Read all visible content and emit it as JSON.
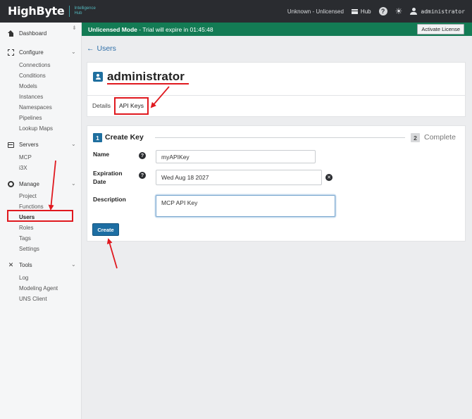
{
  "topbar": {
    "logo": "HighByte",
    "logo_sub_1": "Intelligence",
    "logo_sub_2": "Hub",
    "license_status": "Unknown - Unlicensed",
    "hub_label": "Hub",
    "help_glyph": "?",
    "theme_glyph": "☀",
    "username": "administrator"
  },
  "sidebar": {
    "pin_glyph": "⇟",
    "dashboard": "Dashboard",
    "configure": "Configure",
    "configure_items": [
      "Connections",
      "Conditions",
      "Models",
      "Instances",
      "Namespaces",
      "Pipelines",
      "Lookup Maps"
    ],
    "servers": "Servers",
    "servers_items": [
      "MCP",
      "i3X"
    ],
    "manage": "Manage",
    "manage_items": [
      "Project",
      "Functions",
      "Users",
      "Roles",
      "Tags",
      "Settings"
    ],
    "tools": "Tools",
    "tools_items": [
      "Log",
      "Modeling Agent",
      "UNS Client"
    ],
    "chevron": "⌄"
  },
  "banner": {
    "mode": "Unlicensed Mode",
    "message": " - Trial will expire in 01:45:48",
    "activate_label": "Activate License"
  },
  "page": {
    "back_arrow": "←",
    "back_label": "Users",
    "title": "administrator",
    "tabs": [
      "Details",
      "API Keys"
    ]
  },
  "wizard": {
    "step1_num": "1",
    "step1_label": "Create Key",
    "step2_num": "2",
    "step2_label": "Complete",
    "name_label": "Name",
    "name_value": "myAPIKey",
    "expiration_label_1": "Expiration",
    "expiration_label_2": "Date",
    "expiration_value": "Wed Aug 18 2027",
    "description_label": "Description",
    "description_value": "MCP API Key",
    "help_glyph": "?",
    "clear_glyph": "✕",
    "create_label": "Create"
  },
  "colors": {
    "topbar": "#2a2c30",
    "banner": "#137b54",
    "accent": "#1f6f9f",
    "annotation": "#e0191f"
  }
}
